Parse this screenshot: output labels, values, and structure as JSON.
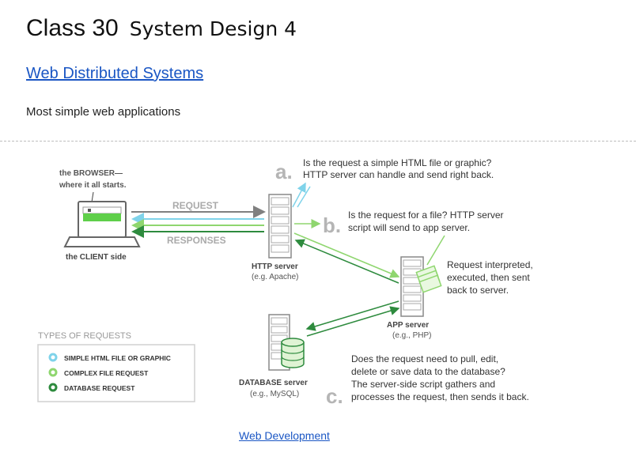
{
  "header": {
    "title": "Class 30",
    "subtitle": "System Design 4"
  },
  "link": {
    "label": "Web Distributed Systems"
  },
  "intro": {
    "text": "Most simple web applications"
  },
  "diagram": {
    "browser_label_1": "the BROWSER—",
    "browser_label_2": "where it all starts.",
    "client_label": "the CLIENT side",
    "request_label": "REQUEST",
    "responses_label": "RESPONSES",
    "http_label": "HTTP server",
    "http_sub": "(e.g. Apache)",
    "app_label": "APP server",
    "app_sub": "(e.g., PHP)",
    "db_label": "DATABASE server",
    "db_sub": "(e.g., MySQL)",
    "note_a_letter": "a.",
    "note_a_line1": "Is the request a simple HTML file or graphic?",
    "note_a_line2": "HTTP server can handle and send right back.",
    "note_b_letter": "b.",
    "note_b_line1": "Is the request for a file? HTTP server",
    "note_b_line2": "script will send to app server.",
    "interpret_line1": "Request interpreted,",
    "interpret_line2": "executed, then sent",
    "interpret_line3": "back to server.",
    "note_c_letter": "c.",
    "note_c_line1": "Does the request need to pull, edit,",
    "note_c_line2": "delete or save data to the database?",
    "note_c_line3": "The server-side script gathers and",
    "note_c_line4": "processes the request, then sends it back.",
    "legend_title": "TYPES OF REQUESTS",
    "legend_items": [
      "SIMPLE HTML FILE OR GRAPHIC",
      "COMPLEX FILE REQUEST",
      "DATABASE REQUEST"
    ],
    "colors": {
      "simple": "#7fd3ea",
      "complex": "#8fd66f",
      "database": "#2e8b3e",
      "server": "#8a8a8a",
      "letter": "#b5b5b5"
    }
  },
  "footer": {
    "link_label": "Web Development"
  }
}
